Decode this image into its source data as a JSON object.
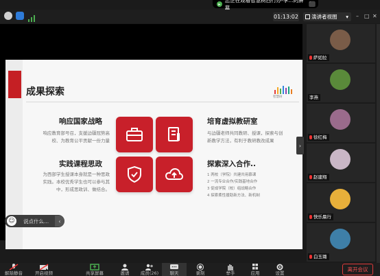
{
  "share_banner": {
    "text": "您正在观看智慧树西行办-李...的屏幕",
    "stop_glyph": "⬛"
  },
  "toolbar": {
    "timer": "01:13:02",
    "view_label": "演讲者视图",
    "minimize": "–",
    "maximize": "□",
    "close": "✕"
  },
  "slide": {
    "title": "成果探索",
    "logo_text": "智慧树",
    "sections": [
      {
        "heading": "响应国家战略",
        "body": [
          "响应教育部号召，支援边疆冠势高",
          "校、为教育公平贡献一份力量"
        ]
      },
      {
        "heading": "培育虚拟教研室",
        "body": [
          "与边疆老师共同教研、授课，探索与创",
          "新教学方法，有利于教研教改成果"
        ]
      },
      {
        "heading": "实践课程思政",
        "body": [
          "为西部学生授课本身就是一种思政",
          "实践。本校优秀学生也可以参与其",
          "中，形成思政训、做结合。"
        ]
      },
      {
        "heading": "探索深入合作..",
        "body": [
          "1 两校（学院）共建共用慕课",
          "2 一流专业合作/实践基地合作",
          "3 促成学院（校）组战略合作",
          "4 探索柔性援助新方法、新机制"
        ]
      }
    ],
    "chat_placeholder": "说点什么...",
    "chat_emoji": "☺",
    "chat_collapse": "‹"
  },
  "side_toggle": "›",
  "participants": [
    {
      "name": "萨如拉",
      "color": "#7a5c48"
    },
    {
      "name": "李燕",
      "color": "#5a8a3a"
    },
    {
      "name": "徐红梅",
      "color": "#9a6b8c"
    },
    {
      "name": "赵建翔",
      "color": "#c9b6c6"
    },
    {
      "name": "快乐晨行",
      "color": "#e8b03a"
    },
    {
      "name": "白玉璐",
      "color": "#3e7fa8"
    }
  ],
  "controls": [
    {
      "label": "解除静音",
      "icon": "mic-icon"
    },
    {
      "label": "开启视频",
      "icon": "video-icon"
    },
    {
      "label": "共享屏幕",
      "icon": "share-screen-icon"
    },
    {
      "label": "邀请",
      "icon": "invite-icon"
    },
    {
      "label": "成员(26)",
      "icon": "members-icon"
    },
    {
      "label": "聊天",
      "icon": "chat-icon"
    },
    {
      "label": "录制",
      "icon": "record-icon"
    },
    {
      "label": "举手",
      "icon": "hand-icon"
    },
    {
      "label": "应用",
      "icon": "apps-icon"
    },
    {
      "label": "设置",
      "icon": "settings-icon"
    }
  ],
  "leave_label": "离开会议",
  "colors": {
    "accent_red": "#c8202a",
    "leave_red": "#e03a3a"
  }
}
